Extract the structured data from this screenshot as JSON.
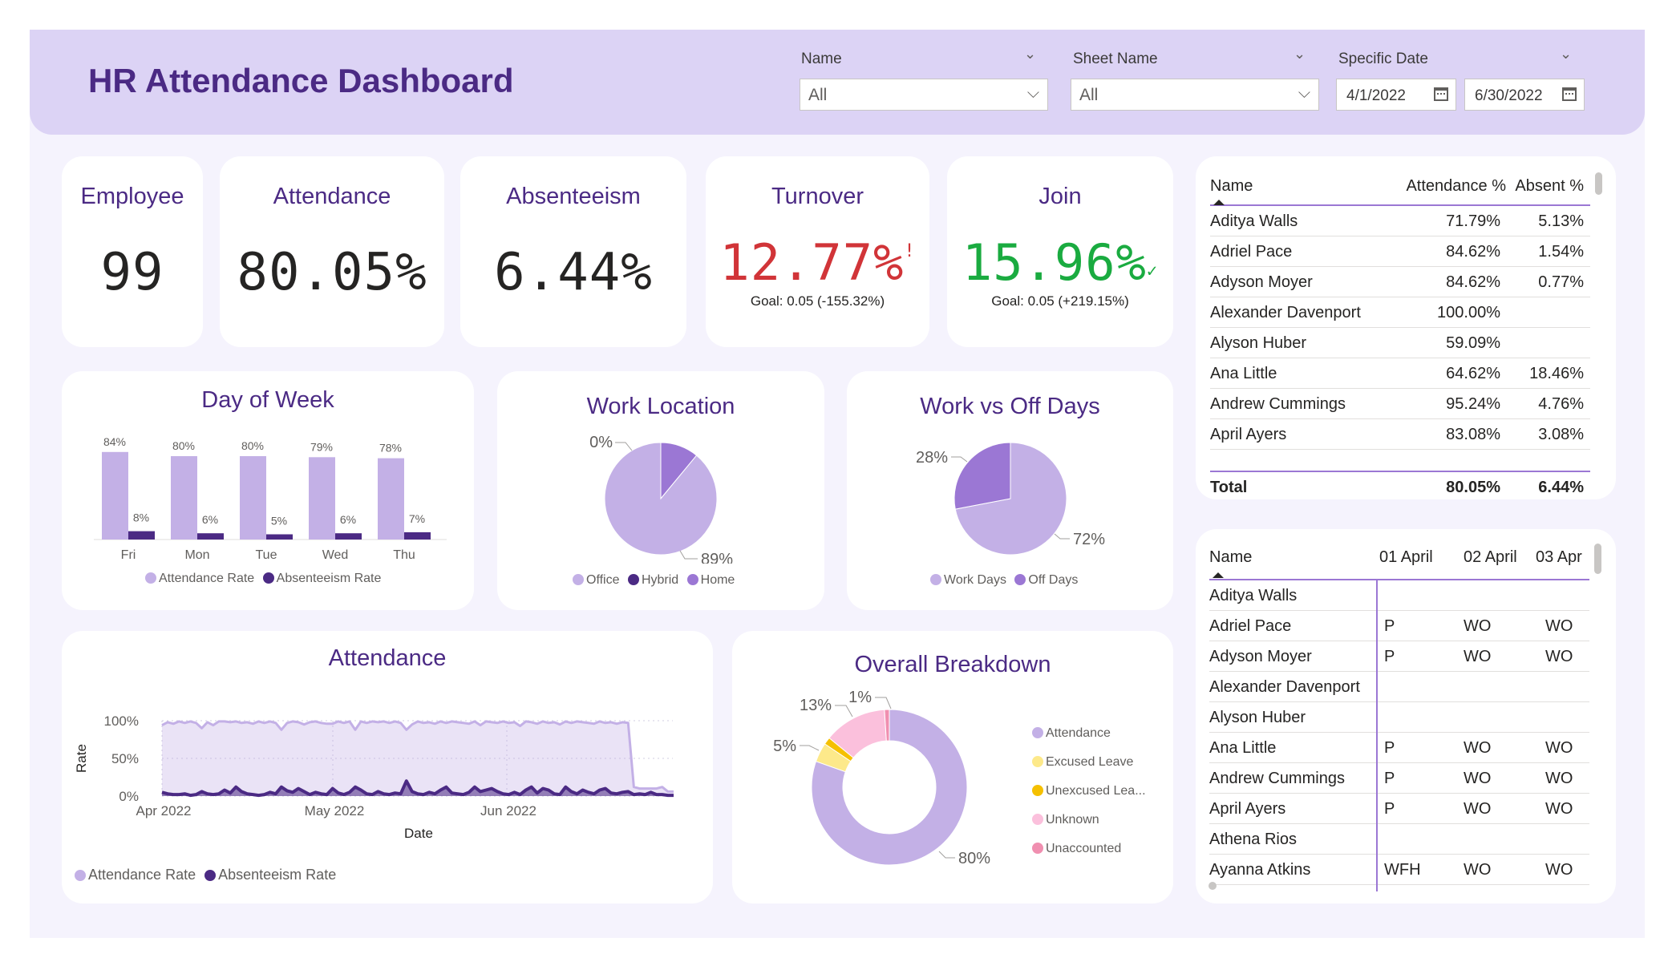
{
  "header": {
    "title": "HR Attendance Dashboard",
    "filters": [
      {
        "label": "Name",
        "value": "All"
      },
      {
        "label": "Sheet Name",
        "value": "All"
      },
      {
        "label": "Specific Date",
        "start": "4/1/2022",
        "end": "6/30/2022"
      }
    ]
  },
  "kpis": {
    "employee": {
      "label": "Employee",
      "value": "99"
    },
    "attendance": {
      "label": "Attendance",
      "value": "80.05%"
    },
    "absenteeism": {
      "label": "Absenteeism",
      "value": "6.44%"
    },
    "turnover": {
      "label": "Turnover",
      "value": "12.77%",
      "goal": "Goal: 0.05 (-155.32%)",
      "status": "!",
      "color": "#d13438"
    },
    "join": {
      "label": "Join",
      "value": "15.96%",
      "goal": "Goal: 0.05 (+219.15%)",
      "status": "✓",
      "color": "#1aab40"
    }
  },
  "colors": {
    "attendance": "#c3b0e6",
    "absenteeism": "#4b2a84",
    "home": "#9b77d4",
    "excused": "#fde98a",
    "unexcused": "#f5c000",
    "unknown": "#fbc0dc",
    "unaccounted": "#f08fb0"
  },
  "day_of_week": {
    "title": "Day of Week",
    "legend": [
      "Attendance Rate",
      "Absenteeism Rate"
    ],
    "chart_data": {
      "type": "bar",
      "categories": [
        "Fri",
        "Mon",
        "Tue",
        "Wed",
        "Thu"
      ],
      "series": [
        {
          "name": "Attendance Rate",
          "values": [
            84,
            80,
            80,
            79,
            78
          ],
          "labels": [
            "84%",
            "80%",
            "80%",
            "79%",
            "78%"
          ]
        },
        {
          "name": "Absenteeism Rate",
          "values": [
            8,
            6,
            5,
            6,
            7
          ],
          "labels": [
            "8%",
            "6%",
            "5%",
            "6%",
            "7%"
          ]
        }
      ],
      "ylim": [
        0,
        100
      ]
    }
  },
  "work_location": {
    "title": "Work Location",
    "legend": [
      "Office",
      "Hybrid",
      "Home"
    ],
    "labels": [
      "0%",
      "89%"
    ],
    "chart_data": {
      "type": "pie",
      "categories": [
        "Office",
        "Hybrid",
        "Home"
      ],
      "values": [
        89,
        0,
        11
      ]
    }
  },
  "work_vs_off": {
    "title": "Work vs Off Days",
    "legend": [
      "Work Days",
      "Off Days"
    ],
    "labels": [
      "28%",
      "72%"
    ],
    "chart_data": {
      "type": "pie",
      "categories": [
        "Work Days",
        "Off Days"
      ],
      "values": [
        72,
        28
      ]
    }
  },
  "attendance_trend": {
    "title": "Attendance",
    "ylabel": "Rate",
    "xlabel": "Date",
    "yticks": [
      "100%",
      "50%",
      "0%"
    ],
    "xticks": [
      "Apr 2022",
      "May 2022",
      "Jun 2022"
    ],
    "legend": [
      "Attendance Rate",
      "Absenteeism Rate"
    ],
    "chart_data": {
      "type": "area",
      "x_start": "2022-04-01",
      "ylim": [
        0,
        100
      ],
      "series": [
        {
          "name": "Attendance Rate",
          "values": [
            94,
            98,
            96,
            99,
            97,
            99,
            97,
            90,
            98,
            94,
            99,
            99,
            98,
            99,
            97,
            98,
            96,
            99,
            97,
            99,
            97,
            88,
            97,
            99,
            98,
            95,
            98,
            99,
            97,
            96,
            96,
            99,
            97,
            99,
            88,
            99,
            97,
            99,
            98,
            99,
            97,
            99,
            97,
            88,
            95,
            99,
            97,
            98,
            96,
            99,
            97,
            99,
            98,
            97,
            96,
            99,
            94,
            99,
            98,
            97,
            99,
            97,
            98,
            93,
            99,
            98,
            96,
            99,
            97,
            98,
            95,
            99,
            97,
            99,
            98,
            97,
            96,
            99,
            97,
            98,
            96,
            98,
            97,
            12,
            10,
            10,
            10,
            10,
            12,
            6,
            6
          ]
        },
        {
          "name": "Absenteeism Rate",
          "values": [
            5,
            3,
            2,
            2,
            3,
            1,
            2,
            6,
            3,
            2,
            3,
            8,
            4,
            12,
            6,
            3,
            2,
            1,
            2,
            5,
            3,
            12,
            7,
            5,
            10,
            6,
            2,
            5,
            3,
            2,
            10,
            4,
            2,
            5,
            12,
            8,
            3,
            2,
            6,
            3,
            2,
            4,
            3,
            20,
            6,
            3,
            2,
            5,
            3,
            8,
            12,
            4,
            3,
            2,
            5,
            12,
            6,
            8,
            10,
            6,
            3,
            2,
            5,
            2,
            8,
            12,
            4,
            10,
            8,
            3,
            2,
            12,
            6,
            3,
            8,
            5,
            3,
            8,
            10,
            4,
            3,
            5,
            6,
            2,
            3,
            2,
            5,
            2,
            2,
            1,
            1
          ]
        }
      ]
    }
  },
  "overall_breakdown": {
    "title": "Overall Breakdown",
    "labels": [
      "1%",
      "13%",
      "5%",
      "80%"
    ],
    "legend": [
      "Attendance",
      "Excused Leave",
      "Unexcused Lea...",
      "Unknown",
      "Unaccounted"
    ],
    "chart_data": {
      "type": "pie",
      "categories": [
        "Attendance",
        "Excused Leave",
        "Unexcused Leave",
        "Unknown",
        "Unaccounted"
      ],
      "values": [
        80,
        4,
        1.5,
        13,
        1
      ]
    }
  },
  "summary_table": {
    "columns": [
      "Name",
      "Attendance %",
      "Absent %"
    ],
    "rows": [
      [
        "Aditya Walls",
        "71.79%",
        "5.13%"
      ],
      [
        "Adriel Pace",
        "84.62%",
        "1.54%"
      ],
      [
        "Adyson Moyer",
        "84.62%",
        "0.77%"
      ],
      [
        "Alexander Davenport",
        "100.00%",
        ""
      ],
      [
        "Alyson Huber",
        "59.09%",
        ""
      ],
      [
        "Ana Little",
        "64.62%",
        "18.46%"
      ],
      [
        "Andrew Cummings",
        "95.24%",
        "4.76%"
      ],
      [
        "April Ayers",
        "83.08%",
        "3.08%"
      ]
    ],
    "total": [
      "Total",
      "80.05%",
      "6.44%"
    ]
  },
  "daily_table": {
    "columns": [
      "Name",
      "01 April",
      "02 April",
      "03 Apr"
    ],
    "rows": [
      [
        "Aditya Walls",
        "",
        "",
        ""
      ],
      [
        "Adriel Pace",
        "P",
        "WO",
        "WO"
      ],
      [
        "Adyson Moyer",
        "P",
        "WO",
        "WO"
      ],
      [
        "Alexander Davenport",
        "",
        "",
        ""
      ],
      [
        "Alyson Huber",
        "",
        "",
        ""
      ],
      [
        "Ana Little",
        "P",
        "WO",
        "WO"
      ],
      [
        "Andrew Cummings",
        "P",
        "WO",
        "WO"
      ],
      [
        "April Ayers",
        "P",
        "WO",
        "WO"
      ],
      [
        "Athena Rios",
        "",
        "",
        ""
      ],
      [
        "Ayanna Atkins",
        "WFH",
        "WO",
        "WO"
      ]
    ]
  }
}
